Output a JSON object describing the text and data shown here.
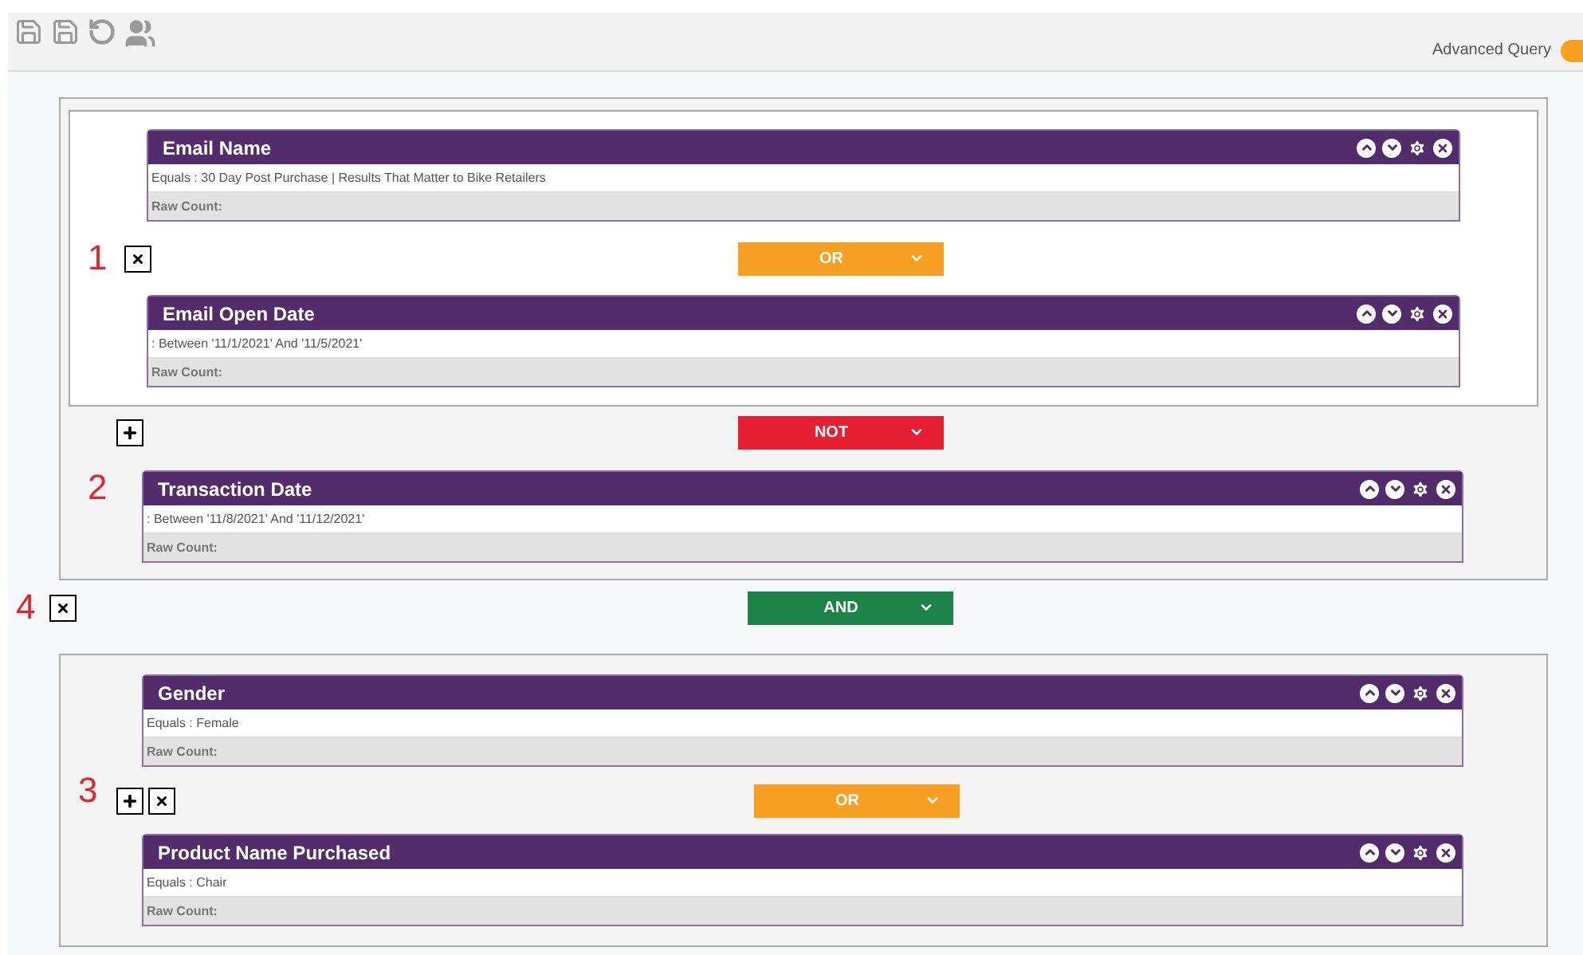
{
  "toolbar": {
    "advanced_query": {
      "label": "Advanced Query",
      "on": true
    }
  },
  "outer_group": {
    "inner_group": {
      "marker": "1",
      "first": {
        "title": "Email Name",
        "criteria": "Equals : 30 Day Post Purchase | Results That Matter to Bike Retailers",
        "raw_count": "Raw Count:"
      },
      "operator": {
        "label": "OR",
        "kind": "or"
      },
      "second": {
        "title": "Email Open Date",
        "criteria": ": Between '11/1/2021' And '11/5/2021'",
        "raw_count": "Raw Count:"
      }
    },
    "operator": {
      "label": "NOT",
      "kind": "not"
    },
    "marker": "2",
    "condition": {
      "title": "Transaction Date",
      "criteria": ": Between '11/8/2021' And '11/12/2021'",
      "raw_count": "Raw Count:"
    }
  },
  "join": {
    "marker": "4",
    "operator": {
      "label": "AND",
      "kind": "and"
    }
  },
  "group_3": {
    "marker": "3",
    "first": {
      "title": "Gender",
      "criteria": "Equals : Female",
      "raw_count": "Raw Count:"
    },
    "operator": {
      "label": "OR",
      "kind": "or"
    },
    "second": {
      "title": "Product Name Purchased",
      "criteria": "Equals : Chair",
      "raw_count": "Raw Count:"
    }
  }
}
